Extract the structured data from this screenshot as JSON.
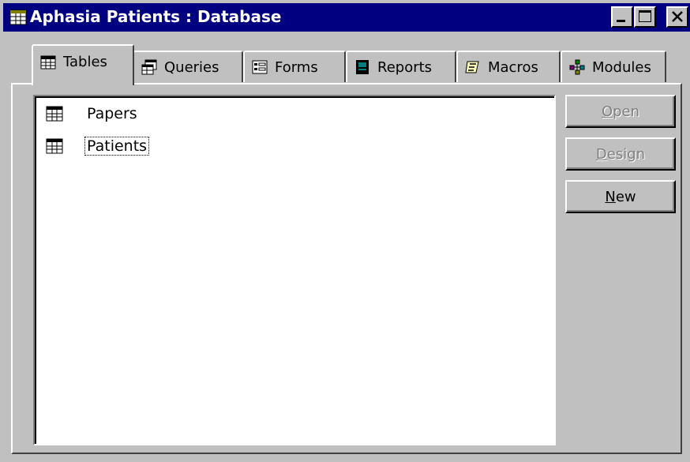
{
  "window": {
    "title": "Aphasia Patients : Database",
    "title_icon": "database-icon",
    "controls": [
      "minimize-icon",
      "maximize-icon",
      "close-icon"
    ]
  },
  "tabs": [
    {
      "label": "Tables",
      "icon": "table-icon",
      "active": true
    },
    {
      "label": "Queries",
      "icon": "query-icon",
      "active": false
    },
    {
      "label": "Forms",
      "icon": "form-icon",
      "active": false
    },
    {
      "label": "Reports",
      "icon": "report-icon",
      "active": false
    },
    {
      "label": "Macros",
      "icon": "macro-icon",
      "active": false
    },
    {
      "label": "Modules",
      "icon": "module-icon",
      "active": false
    }
  ],
  "objects": [
    {
      "label": "Papers",
      "icon": "table-icon",
      "focused": false
    },
    {
      "label": "Patients",
      "icon": "table-icon",
      "focused": true
    }
  ],
  "buttons": {
    "open": {
      "label": "Open",
      "enabled": false
    },
    "design": {
      "label": "Design",
      "enabled": false
    },
    "new": {
      "label": "New",
      "enabled": true
    }
  },
  "colors": {
    "titlebar": "#000080",
    "face": "#c0c0c0",
    "disabled_text": "#808080"
  }
}
